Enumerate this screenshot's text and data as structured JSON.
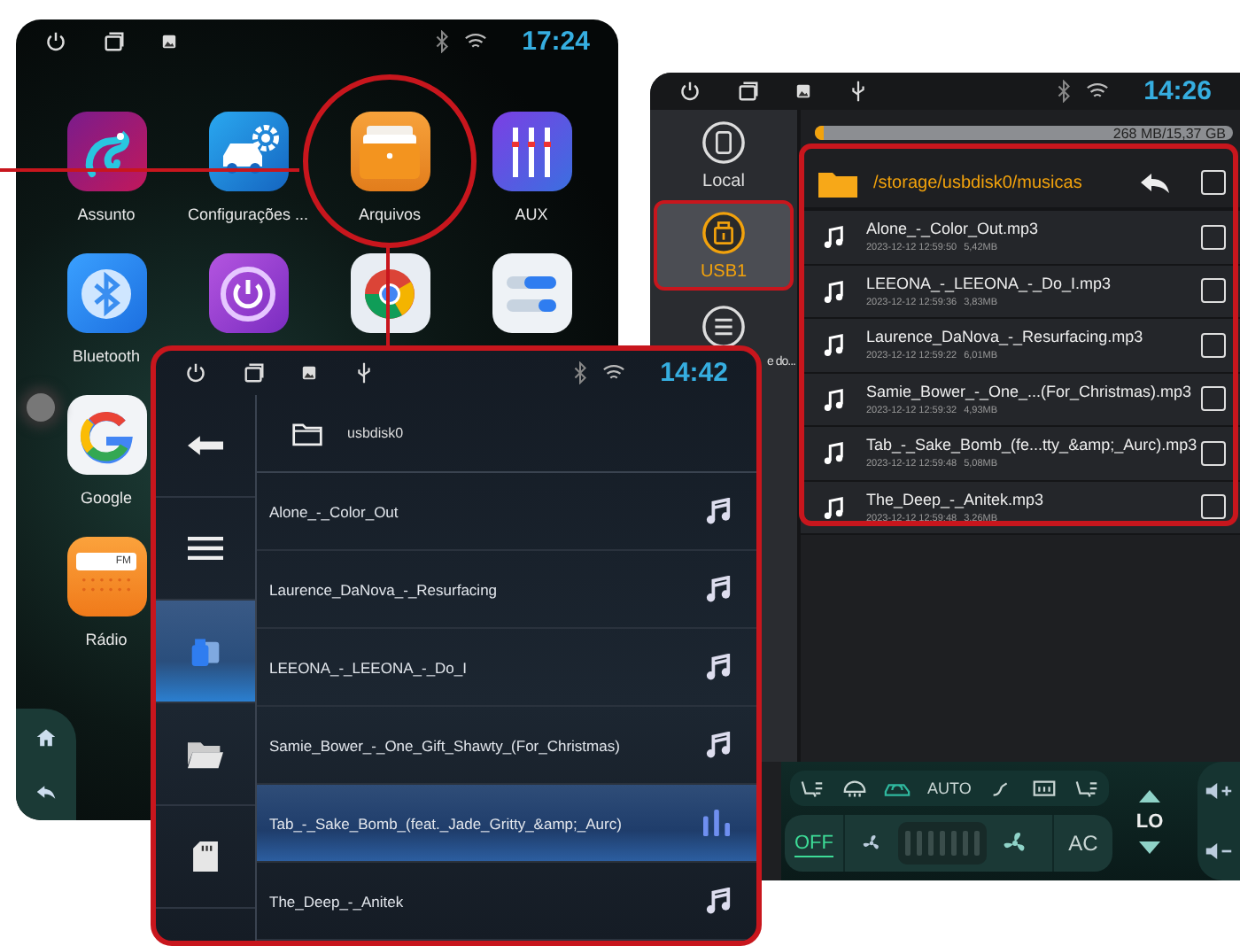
{
  "home_screen": {
    "status_bar": {
      "usb": false,
      "time": "17:24"
    },
    "app_rows": [
      [
        {
          "kind": "chameleon",
          "label": "Assunto",
          "highlighted": false
        },
        {
          "kind": "car-settings",
          "label": "Configurações ...",
          "highlighted": false
        },
        {
          "kind": "files",
          "label": "Arquivos",
          "highlighted": true
        },
        {
          "kind": "aux",
          "label": "AUX",
          "highlighted": false
        }
      ],
      [
        {
          "kind": "bluetooth",
          "label": "Bluetooth",
          "highlighted": false
        },
        {
          "kind": "power",
          "highlighted": false
        },
        {
          "kind": "chrome",
          "highlighted": false
        },
        {
          "kind": "toggles",
          "highlighted": false
        }
      ],
      [
        {
          "kind": "google",
          "label": "Google",
          "highlighted": false
        }
      ],
      [
        {
          "kind": "radio",
          "label": "Rádio",
          "icon_text": "FM",
          "highlighted": false
        }
      ]
    ]
  },
  "file_manager": {
    "status_bar": {
      "usb": true,
      "time": "14:26"
    },
    "storage": {
      "text": "268 MB/15,37 GB",
      "level": 0.02
    },
    "sources": [
      {
        "kind": "chip",
        "label": "Local",
        "selected": false
      },
      {
        "kind": "usb",
        "label": "USB1",
        "selected": true
      },
      {
        "kind": "list",
        "label": "e do...",
        "selected": false
      }
    ],
    "folder": {
      "path": "/storage/usbdisk0/musicas",
      "checked": false
    },
    "files": [
      {
        "name": "Alone_-_Color_Out.mp3",
        "date": "2023-12-12 12:59:50",
        "size": "5,42MB",
        "checked": false
      },
      {
        "name": "LEEONA_-_LEEONA_-_Do_I.mp3",
        "date": "2023-12-12 12:59:36",
        "size": "3,83MB",
        "checked": false
      },
      {
        "name": "Laurence_DaNova_-_Resurfacing.mp3",
        "date": "2023-12-12 12:59:22",
        "size": "6,01MB",
        "checked": false
      },
      {
        "name": "Samie_Bower_-_One_...(For_Christmas).mp3",
        "date": "2023-12-12 12:59:32",
        "size": "4,93MB",
        "checked": false
      },
      {
        "name": "Tab_-_Sake_Bomb_(fe...tty_&amp;_Aurc).mp3",
        "date": "2023-12-12 12:59:48",
        "size": "5,08MB",
        "checked": false
      },
      {
        "name": "The_Deep_-_Anitek.mp3",
        "date": "2023-12-12 12:59:48",
        "size": "3,26MB",
        "checked": false
      }
    ],
    "climate": {
      "controls": [
        {
          "kind": "seat-heat",
          "active": false
        },
        {
          "kind": "rear-defrost",
          "active": false
        },
        {
          "kind": "recirculation",
          "active": true
        },
        {
          "kind": "auto",
          "label": "AUTO",
          "active": false
        },
        {
          "kind": "airflow",
          "active": false
        },
        {
          "kind": "front-defrost",
          "active": false
        },
        {
          "kind": "seat-heat",
          "active": false
        }
      ],
      "power": {
        "label": "OFF",
        "on": true
      },
      "ac": "AC",
      "temperature": "LO"
    }
  },
  "music_player": {
    "status_bar": {
      "usb": true,
      "time": "14:42"
    },
    "nav": [
      {
        "kind": "back",
        "selected": false
      },
      {
        "kind": "menu",
        "selected": false
      },
      {
        "kind": "usb",
        "selected": true
      },
      {
        "kind": "folder",
        "selected": false
      },
      {
        "kind": "sd-card",
        "selected": false
      }
    ],
    "folder": "usbdisk0",
    "tracks": [
      {
        "title": "Alone_-_Color_Out",
        "selected": false
      },
      {
        "title": "Laurence_DaNova_-_Resurfacing",
        "selected": false
      },
      {
        "title": "LEEONA_-_LEEONA_-_Do_I",
        "selected": false
      },
      {
        "title": "Samie_Bower_-_One_Gift_Shawty_(For_Christmas)",
        "selected": false
      },
      {
        "title": "Tab_-_Sake_Bomb_(feat._Jade_Gritty_&amp;_Aurc)",
        "selected": true
      },
      {
        "title": "The_Deep_-_Anitek",
        "selected": false
      }
    ]
  }
}
